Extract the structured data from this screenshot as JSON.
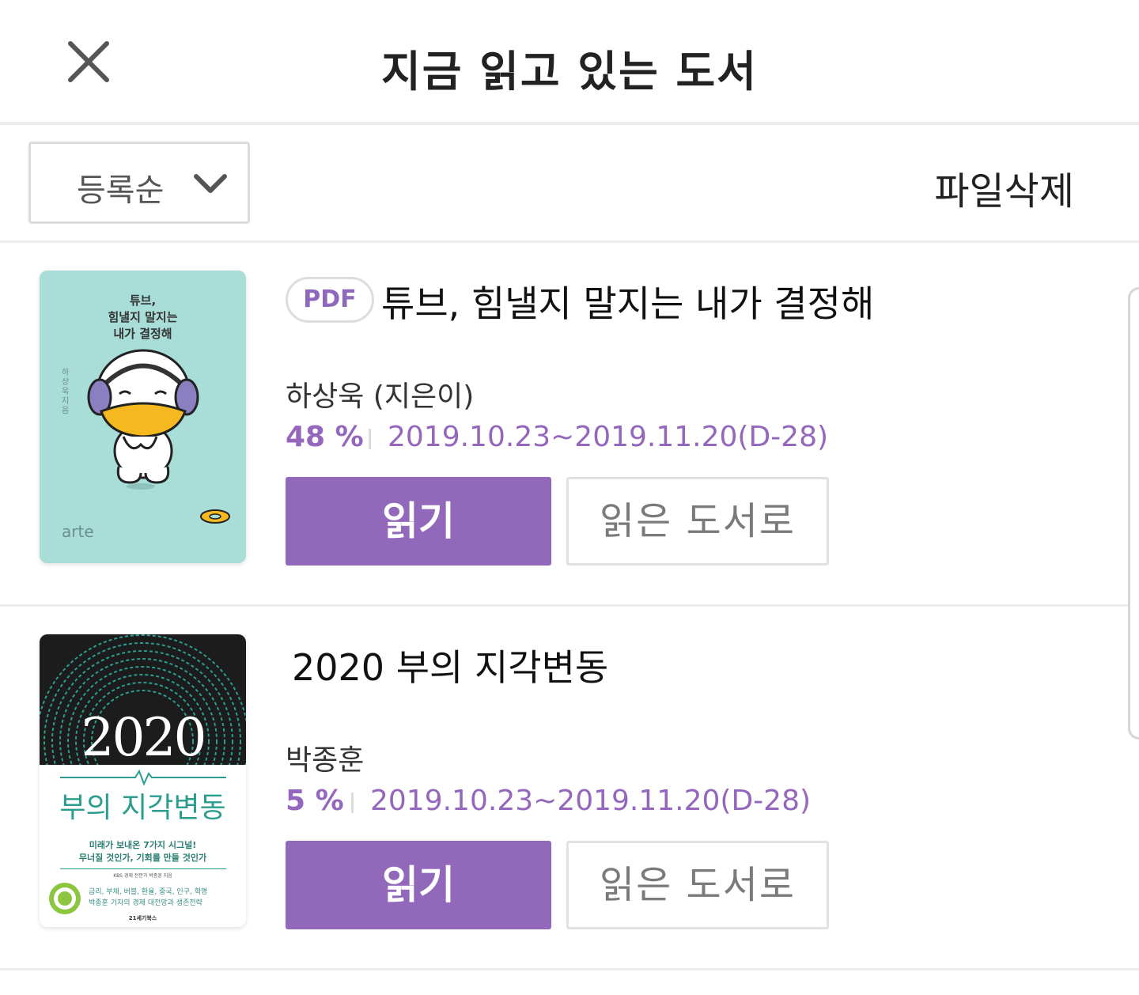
{
  "header": {
    "title": "지금 읽고 있는 도서",
    "close_icon": "close-icon"
  },
  "toolbar": {
    "sort_label": "등록순",
    "sort_icon": "chevron-down-icon",
    "delete_label": "파일삭제"
  },
  "books": [
    {
      "badge": "PDF",
      "title": "튜브, 힘낼지 말지는 내가 결정해",
      "author": "하상욱 (지은이)",
      "progress": "48 %",
      "period": "2019.10.23~2019.11.20(D-28)",
      "read_label": "읽기",
      "mark_read_label": "읽은 도서로",
      "cover": {
        "title_lines": [
          "튜브,",
          "힘낼지 말지는",
          "내가 결정해"
        ],
        "side_author": "하상욱 지음",
        "publisher": "arte"
      }
    },
    {
      "title": "2020 부의 지각변동",
      "author": "박종훈",
      "progress": "5 %",
      "period": "2019.10.23~2019.11.20(D-28)",
      "read_label": "읽기",
      "mark_read_label": "읽은 도서로",
      "cover": {
        "year": "2020",
        "title": "부의 지각변동",
        "tagline_1": "미래가 보내온 7가지 시그널!",
        "tagline_2": "무너질 것인가, 기회를 만들 것인가",
        "byline": "KBS 경제 전문가 박종훈 지음",
        "keywords": "금리, 부채, 버블, 환율, 중국, 인구, 혁명",
        "subtitle": "박종훈 기자의 경제 대전망과 생존전략",
        "publisher": "21세기북스"
      }
    }
  ],
  "colors": {
    "accent": "#9268bb",
    "accent_text": "#9467bd",
    "divider": "#ececec",
    "cover1_bg": "#a9ddd7",
    "cover2_dark": "#1c1c1c",
    "cover2_teal": "#2a9d8f"
  }
}
